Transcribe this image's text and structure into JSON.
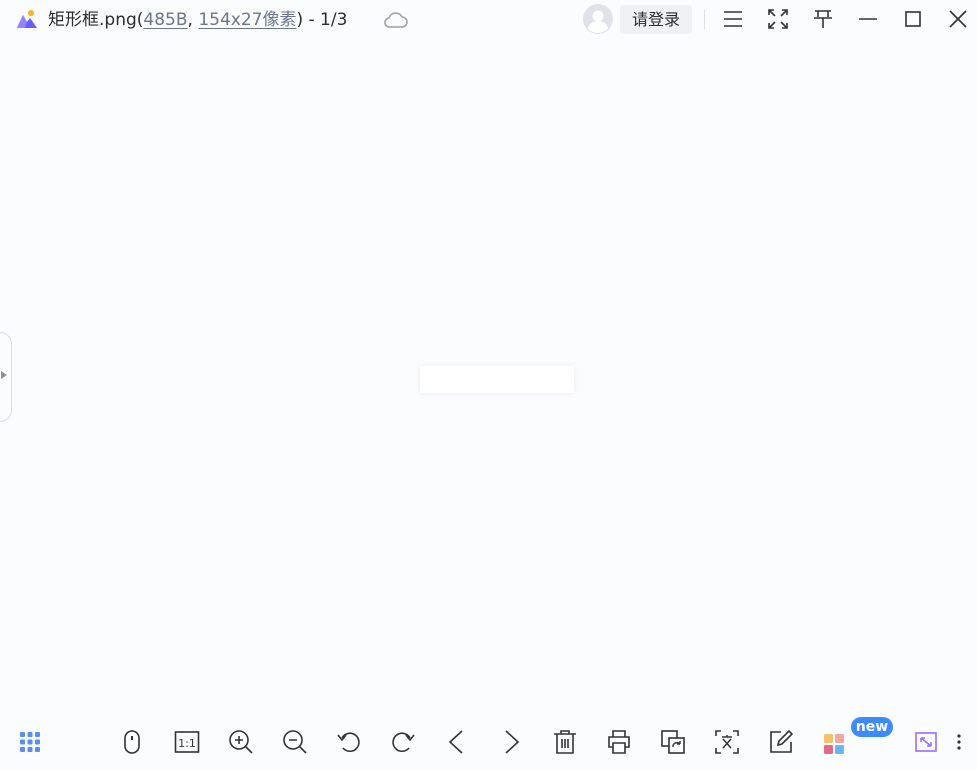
{
  "titlebar": {
    "filename": "矩形框.png",
    "open_paren": "(",
    "filesize": "485B",
    "comma": ",",
    "dimensions": "154x27像素",
    "close_counter": ") - 1/3",
    "login_label": "请登录"
  },
  "icons": {
    "logo": "app-logo-icon",
    "cloud": "cloud-icon",
    "avatar": "user-avatar-icon",
    "menu": "menu-icon",
    "fullscreen": "fullscreen-icon",
    "pin": "pin-icon",
    "minimize": "minimize-icon",
    "maximize": "maximize-icon",
    "close": "close-icon"
  },
  "toolbar": {
    "actual_size_label": "1:1",
    "new_badge": "new",
    "items": [
      "thumbnail-grid",
      "mouse-mode",
      "actual-size",
      "zoom-in",
      "zoom-out",
      "rotate-left",
      "rotate-right",
      "previous",
      "next",
      "delete",
      "print",
      "image-convert",
      "ocr-text",
      "edit",
      "apps",
      "fit-window",
      "more"
    ]
  },
  "colors": {
    "background": "#fbfcfe",
    "accent_blue": "#3d8cff",
    "icon_dark": "#333333",
    "logo_purple": "#6a5cff",
    "logo_orange": "#ffb020",
    "fit_icon_purple": "#9b6cff"
  }
}
